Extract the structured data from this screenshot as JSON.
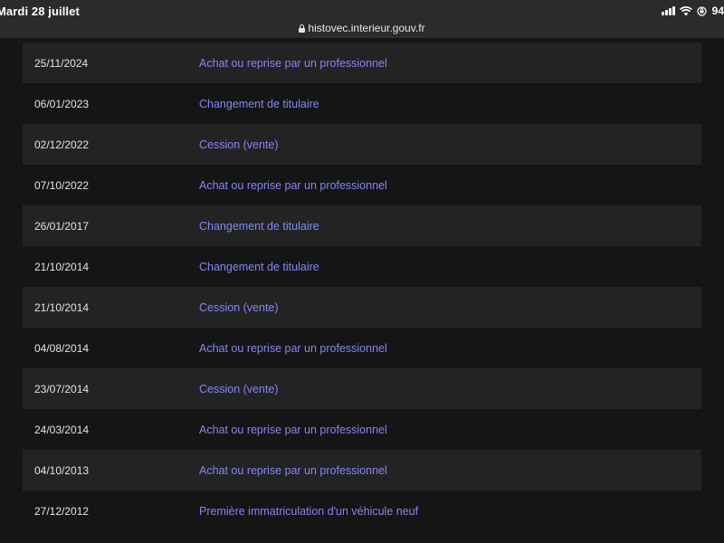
{
  "status_bar": {
    "date": "Mardi 28 juillet",
    "battery": "94"
  },
  "browser": {
    "url": "histovec.interieur.gouv.fr"
  },
  "history": [
    {
      "date": "25/11/2024",
      "event": "Achat ou reprise par un professionnel"
    },
    {
      "date": "06/01/2023",
      "event": "Changement de titulaire"
    },
    {
      "date": "02/12/2022",
      "event": "Cession (vente)"
    },
    {
      "date": "07/10/2022",
      "event": "Achat ou reprise par un professionnel"
    },
    {
      "date": "26/01/2017",
      "event": "Changement de titulaire"
    },
    {
      "date": "21/10/2014",
      "event": "Changement de titulaire"
    },
    {
      "date": "21/10/2014",
      "event": "Cession (vente)"
    },
    {
      "date": "04/08/2014",
      "event": "Achat ou reprise par un professionnel"
    },
    {
      "date": "23/07/2014",
      "event": "Cession (vente)"
    },
    {
      "date": "24/03/2014",
      "event": "Achat ou reprise par un professionnel"
    },
    {
      "date": "04/10/2013",
      "event": "Achat ou reprise par un professionnel"
    },
    {
      "date": "27/12/2012",
      "event": "Première immatriculation d'un véhicule neuf"
    }
  ],
  "colors": {
    "background": "#151515",
    "row_alt": "#232323",
    "link": "#8585f6",
    "status_bar": "#2b2b2b"
  },
  "icons": [
    "lock-icon",
    "signal-icon",
    "wifi-icon",
    "orientation-lock-icon"
  ]
}
